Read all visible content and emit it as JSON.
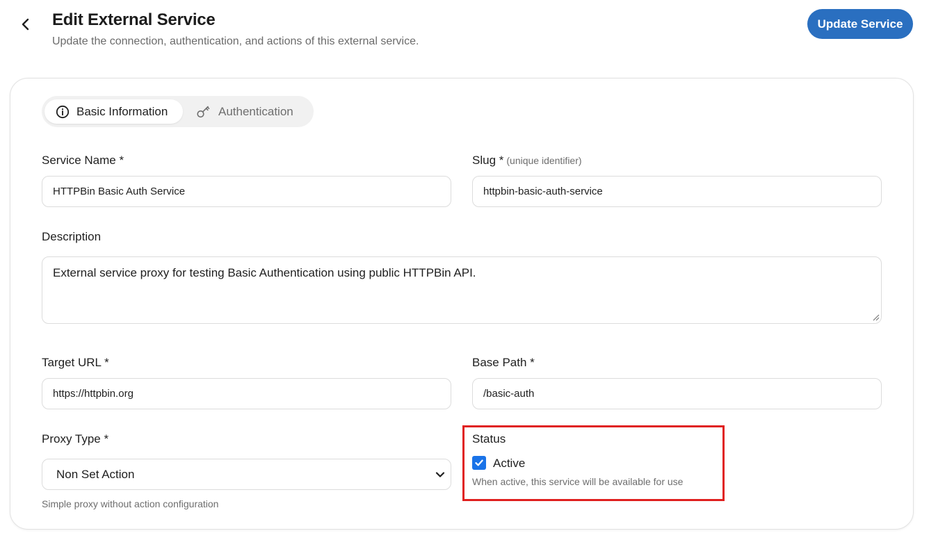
{
  "header": {
    "title": "Edit External Service",
    "subtitle": "Update the connection, authentication, and actions of this external service.",
    "update_button": "Update Service"
  },
  "tabs": [
    {
      "label": "Basic Information",
      "icon": "info-icon",
      "active": true
    },
    {
      "label": "Authentication",
      "icon": "key-icon",
      "active": false
    }
  ],
  "form": {
    "service_name": {
      "label": "Service Name *",
      "value": "HTTPBin Basic Auth Service"
    },
    "slug": {
      "label": "Slug *",
      "hint": "(unique identifier)",
      "value": "httpbin-basic-auth-service"
    },
    "description": {
      "label": "Description",
      "value": "External service proxy for testing Basic Authentication using public HTTPBin API."
    },
    "target_url": {
      "label": "Target URL *",
      "value": "https://httpbin.org"
    },
    "base_path": {
      "label": "Base Path *",
      "value": "/basic-auth"
    },
    "proxy_type": {
      "label": "Proxy Type *",
      "selected": "Non Set Action",
      "help": "Simple proxy without action configuration"
    },
    "status": {
      "label": "Status",
      "checkbox_label": "Active",
      "checked": true,
      "help": "When active, this service will be available for use"
    }
  },
  "colors": {
    "accent": "#2a6fc0",
    "checkbox": "#1a73e8",
    "highlight_border": "#e0201f"
  }
}
